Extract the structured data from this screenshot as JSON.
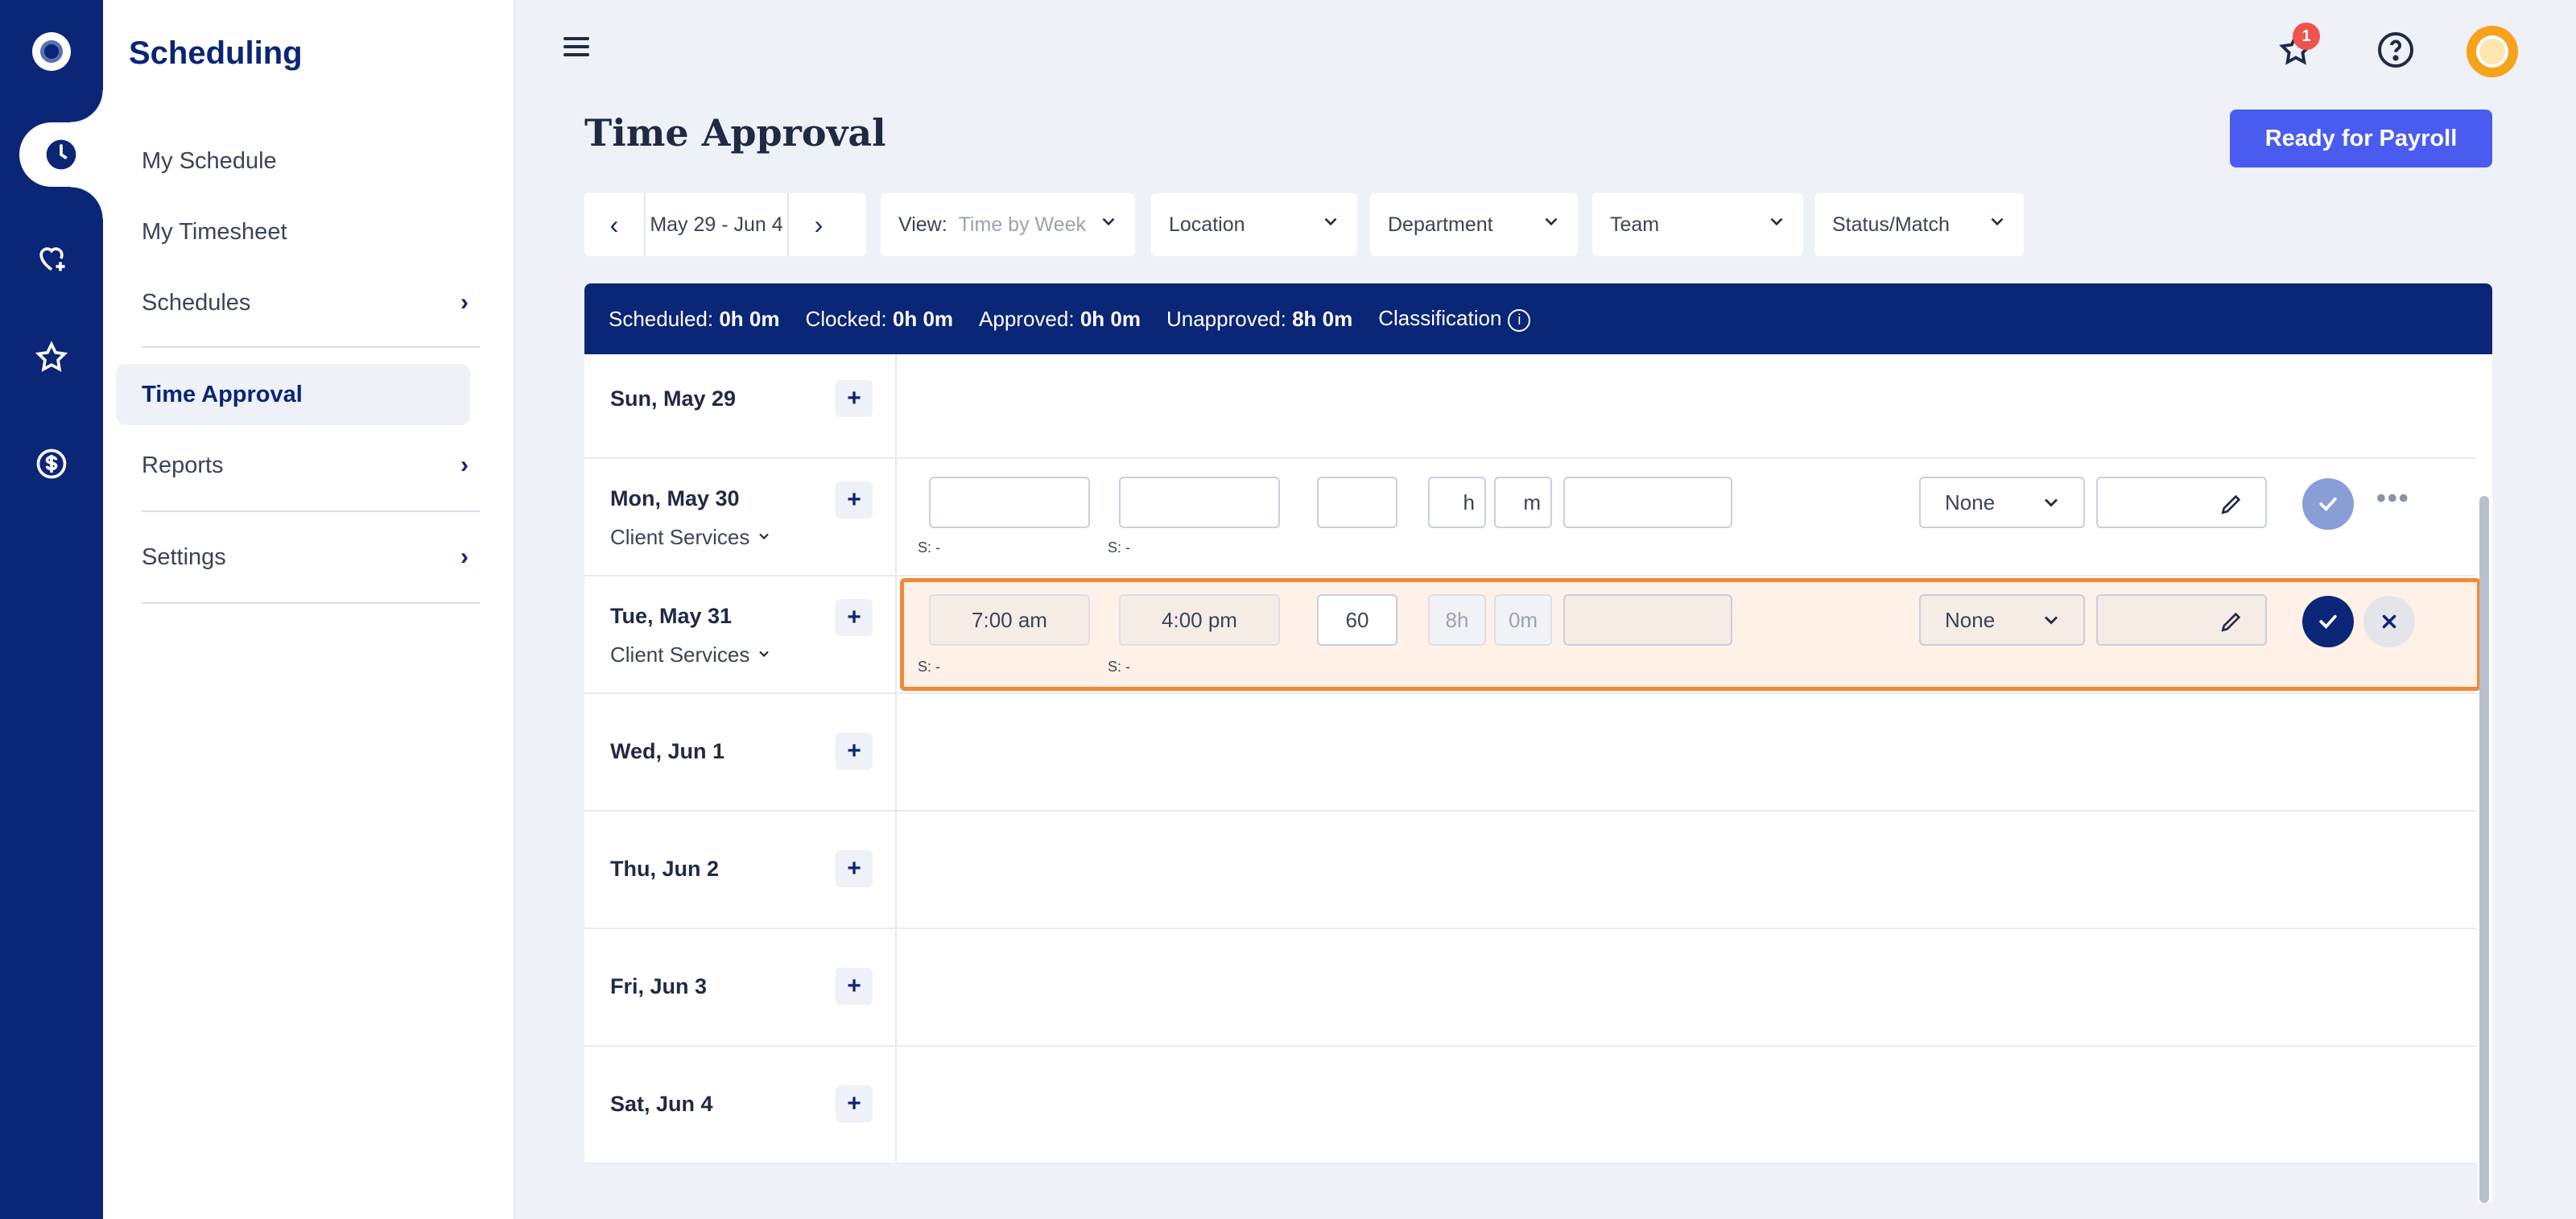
{
  "app": {
    "section_title": "Scheduling",
    "page_title": "Time Approval",
    "primary_action": "Ready for Payroll",
    "notification_count": "1"
  },
  "sidebar": {
    "items": [
      {
        "label": "My Schedule",
        "has_submenu": false
      },
      {
        "label": "My Timesheet",
        "has_submenu": false
      },
      {
        "label": "Schedules",
        "has_submenu": true
      },
      {
        "label": "Time Approval",
        "has_submenu": false,
        "active": true
      },
      {
        "label": "Reports",
        "has_submenu": true
      },
      {
        "label": "Settings",
        "has_submenu": true
      }
    ]
  },
  "rail": {
    "icons": [
      "logo-icon",
      "clock-icon",
      "heart-plus-icon",
      "star-icon",
      "dollar-icon"
    ]
  },
  "filters": {
    "date_range": "May 29 - Jun 4",
    "view_label": "View:",
    "view_value": "Time by Week",
    "location": "Location",
    "department": "Department",
    "team": "Team",
    "status": "Status/Match"
  },
  "summary": {
    "scheduled_label": "Scheduled:",
    "scheduled_value": "0h 0m",
    "clocked_label": "Clocked:",
    "clocked_value": "0h 0m",
    "approved_label": "Approved:",
    "approved_value": "0h 0m",
    "unapproved_label": "Unapproved:",
    "unapproved_value": "8h 0m",
    "classification_label": "Classification"
  },
  "days": [
    {
      "label": "Sun, May 29"
    },
    {
      "label": "Mon, May 30",
      "department": "Client Services"
    },
    {
      "label": "Tue, May 31",
      "department": "Client Services"
    },
    {
      "label": "Wed, Jun 1"
    },
    {
      "label": "Thu, Jun 2"
    },
    {
      "label": "Fri, Jun 3"
    },
    {
      "label": "Sat, Jun 4"
    }
  ],
  "entries": {
    "mon": {
      "start": "",
      "end": "",
      "break": "",
      "hours_suffix": "h",
      "minutes_suffix": "m",
      "note": "",
      "sched_start": "S:  -",
      "sched_end": "S:  -",
      "pay_type": "None"
    },
    "tue": {
      "start": "7:00 am",
      "end": "4:00 pm",
      "break": "60",
      "hours": "8h",
      "minutes": "0m",
      "note": "",
      "sched_start": "S:  -",
      "sched_end": "S:  -",
      "pay_type": "None"
    }
  },
  "plus_label": "+",
  "more_label": "•••",
  "colors": {
    "brand_navy": "#0b2577",
    "primary_button": "#4a5cf0",
    "edit_highlight_border": "#f08a36",
    "edit_highlight_bg": "#fff1e8",
    "badge": "#ef5350"
  }
}
